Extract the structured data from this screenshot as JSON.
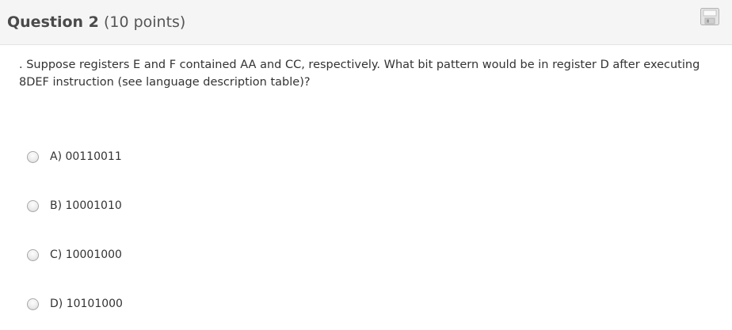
{
  "question": {
    "title": "Question 2",
    "points": "(10 points)",
    "text": ". Suppose registers E and F contained AA and CC, respectively. What bit pattern would be in register D after executing 8DEF instruction (see language description table)?"
  },
  "save_icon": "floppy-disk-icon",
  "options": [
    {
      "label": "A) 00110011"
    },
    {
      "label": "B) 10001010"
    },
    {
      "label": "C) 10001000"
    },
    {
      "label": "D) 10101000"
    }
  ],
  "colors": {
    "header_bg": "#f5f5f5",
    "text": "#333333",
    "title": "#4a4a4a"
  }
}
